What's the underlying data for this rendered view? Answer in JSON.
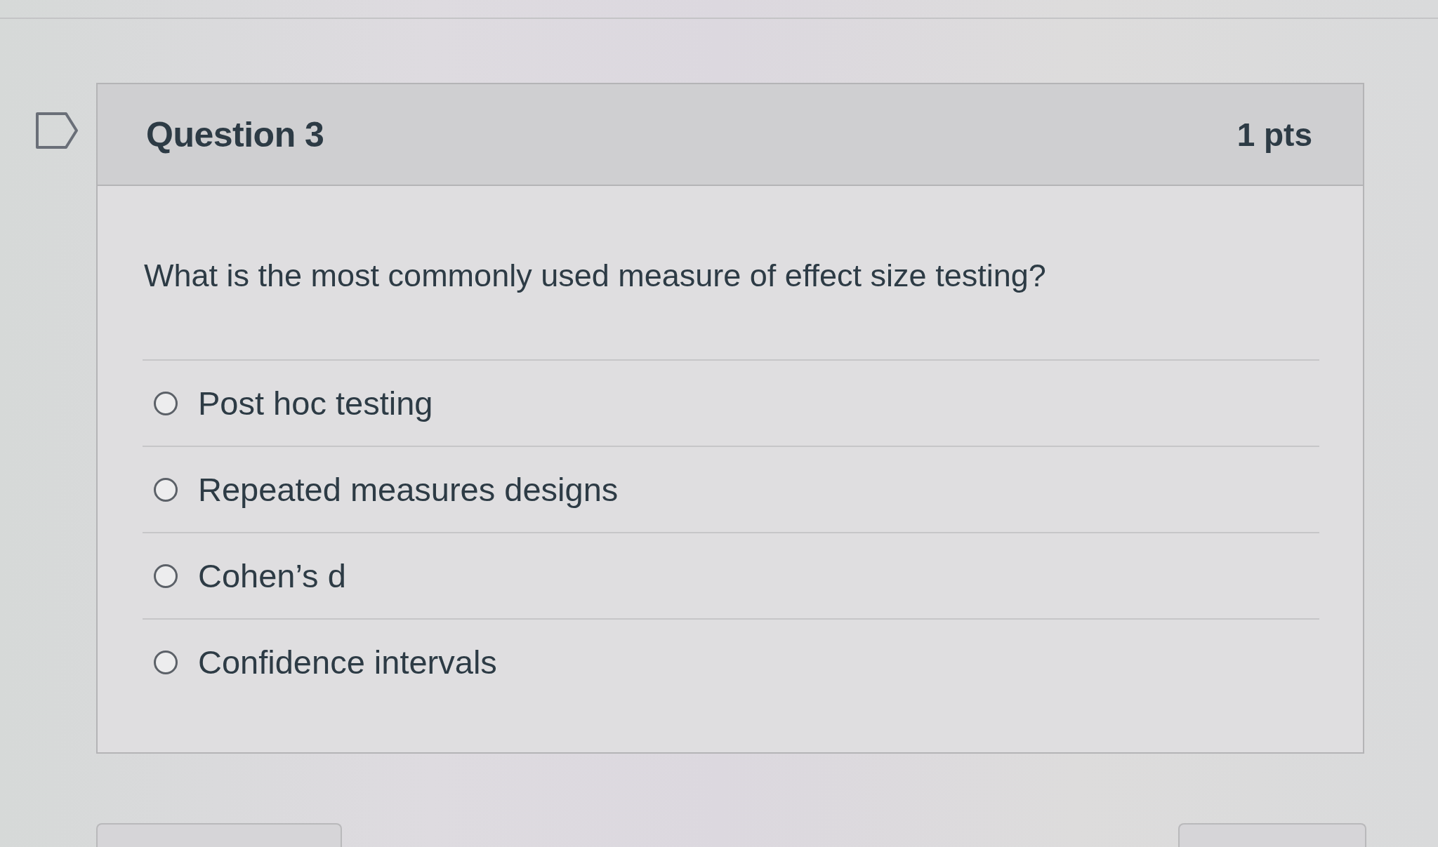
{
  "question": {
    "title": "Question 3",
    "points": "1 pts",
    "text": "What is the most commonly used measure of effect size testing?",
    "answers": [
      {
        "label": "Post hoc testing",
        "selected": false
      },
      {
        "label": "Repeated measures designs",
        "selected": false
      },
      {
        "label": "Cohen’s d",
        "selected": false
      },
      {
        "label": "Confidence intervals",
        "selected": false
      }
    ]
  }
}
